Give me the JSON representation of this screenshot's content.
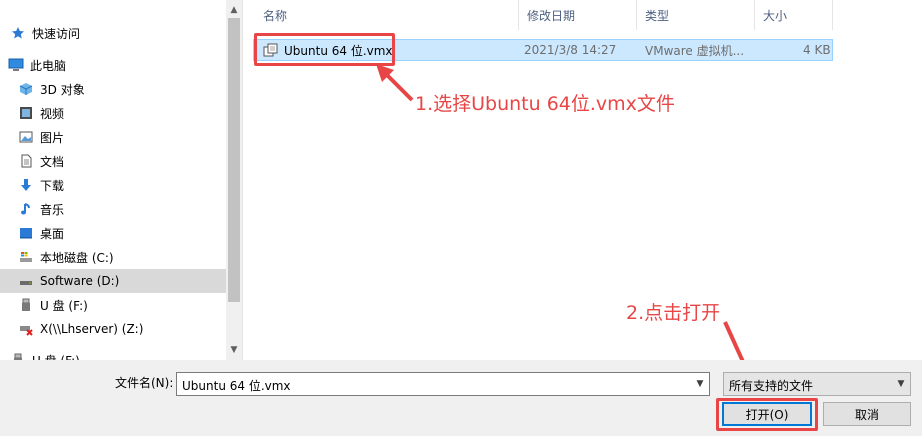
{
  "sidebar": {
    "items": [
      {
        "label": "快速访问",
        "icon": "pin-star-icon"
      },
      {
        "label": "此电脑",
        "icon": "computer-icon"
      },
      {
        "label": "3D 对象",
        "icon": "cube-3d-icon"
      },
      {
        "label": "视频",
        "icon": "video-icon"
      },
      {
        "label": "图片",
        "icon": "picture-icon"
      },
      {
        "label": "文档",
        "icon": "document-icon"
      },
      {
        "label": "下载",
        "icon": "download-arrow-icon"
      },
      {
        "label": "音乐",
        "icon": "music-note-icon"
      },
      {
        "label": "桌面",
        "icon": "desktop-icon"
      },
      {
        "label": "本地磁盘 (C:)",
        "icon": "drive-c-icon"
      },
      {
        "label": "Software (D:)",
        "icon": "drive-d-icon"
      },
      {
        "label": "U 盘 (F:)",
        "icon": "usb-drive-icon"
      },
      {
        "label": "X(\\\\Lhserver) (Z:)",
        "icon": "network-drive-disconnected-icon"
      },
      {
        "label": "U 盘 (F:)",
        "icon": "usb-drive-icon"
      }
    ]
  },
  "file_list": {
    "columns": {
      "name": "名称",
      "modified": "修改日期",
      "type": "类型",
      "size": "大小"
    },
    "rows": [
      {
        "name": "Ubuntu 64 位.vmx",
        "modified": "2021/3/8 14:27",
        "type": "VMware 虚拟机...",
        "size": "4 KB",
        "icon": "vmx-file-icon"
      }
    ]
  },
  "annotations": {
    "step1": "1.选择Ubuntu 64位.vmx文件",
    "step2": "2.点击打开"
  },
  "footer": {
    "filename_label": "文件名(N):",
    "filename_value": "Ubuntu 64 位.vmx",
    "filetype_value": "所有支持的文件",
    "open_label": "打开(O)",
    "cancel_label": "取消"
  },
  "colors": {
    "annotation": "#e84646",
    "selection": "#cce8ff",
    "accent": "#0078d7"
  }
}
